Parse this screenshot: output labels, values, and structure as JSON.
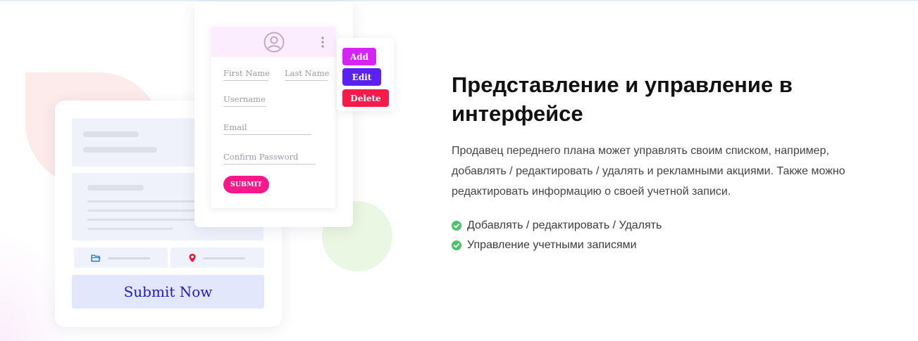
{
  "illustration": {
    "submit_now_label": "Submit Now",
    "form": {
      "first_name_placeholder": "First Name",
      "last_name_placeholder": "Last Name",
      "username_placeholder": "Username",
      "email_placeholder": "Email",
      "confirm_password_placeholder": "Confirm Password",
      "submit_label": "SUBMIT"
    },
    "actions": {
      "add_label": "Add",
      "edit_label": "Edit",
      "delete_label": "Delete"
    },
    "icons": [
      "user-avatar-icon",
      "kebab-menu-icon",
      "folder-icon",
      "location-pin-icon"
    ]
  },
  "section": {
    "title": "Представление и управление в интерфейсе",
    "description": "Продавец переднего плана может управлять своим списком, например, добавлять / редактировать / удалять и рекламными акциями. Также можно редактировать информацию о своей учетной записи.",
    "features": [
      "Добавлять / редактировать / Удалять",
      "Управление учетными записями"
    ]
  },
  "colors": {
    "accent_pink": "#f7198a",
    "add_button": "#d525f2",
    "edit_button": "#5a22f0",
    "delete_button": "#f71a4a",
    "check_green": "#4cc26a",
    "submit_now_text": "#1c1ac9"
  }
}
